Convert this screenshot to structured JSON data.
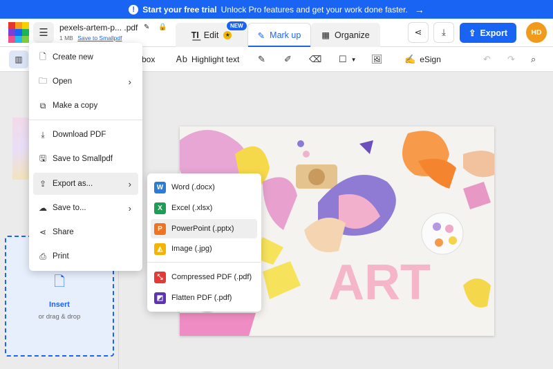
{
  "banner": {
    "cta": "Start your free trial",
    "text": "Unlock Pro features and get your work done faster."
  },
  "file": {
    "name": "pexels-artem-p... .pdf",
    "size": "1 MB",
    "save_link": "Save to Smallpdf"
  },
  "tabs": {
    "edit": "Edit",
    "new_badge": "NEW",
    "markup": "Mark up",
    "organize": "Organize"
  },
  "header": {
    "export": "Export",
    "avatar": "HD"
  },
  "toolbar": {
    "textbox_partial": "box",
    "highlight": "Highlight text",
    "esign": "eSign"
  },
  "file_menu": {
    "items": [
      {
        "label": "Create new",
        "icon": "file-plus-icon"
      },
      {
        "label": "Open",
        "icon": "folder-icon"
      },
      {
        "label": "Make a copy",
        "icon": "copy-icon"
      },
      {
        "label": "Download PDF",
        "icon": "download-icon"
      },
      {
        "label": "Save to Smallpdf",
        "icon": "save-icon"
      },
      {
        "label": "Export as...",
        "icon": "export-icon"
      },
      {
        "label": "Save to...",
        "icon": "cloud-upload-icon"
      },
      {
        "label": "Share",
        "icon": "share-icon"
      },
      {
        "label": "Print",
        "icon": "printer-icon"
      }
    ]
  },
  "export_menu": {
    "items": [
      {
        "label": "Word (.docx)",
        "letter": "W",
        "color": "#2b7cd3"
      },
      {
        "label": "Excel (.xlsx)",
        "letter": "X",
        "color": "#1f9d55"
      },
      {
        "label": "PowerPoint (.pptx)",
        "letter": "P",
        "color": "#f0741f"
      },
      {
        "label": "Image (.jpg)",
        "letter": "",
        "color": "#f4b400"
      },
      {
        "label": "Compressed PDF (.pdf)",
        "letter": "",
        "color": "#e53935"
      },
      {
        "label": "Flatten PDF (.pdf)",
        "letter": "",
        "color": "#5e35b1"
      }
    ]
  },
  "left_panel": {
    "insert": "Insert",
    "drag": "or drag & drop"
  },
  "canvas_text": "ART",
  "colors": {
    "accent": "#1a64f4",
    "avatar": "#f09b1c"
  }
}
